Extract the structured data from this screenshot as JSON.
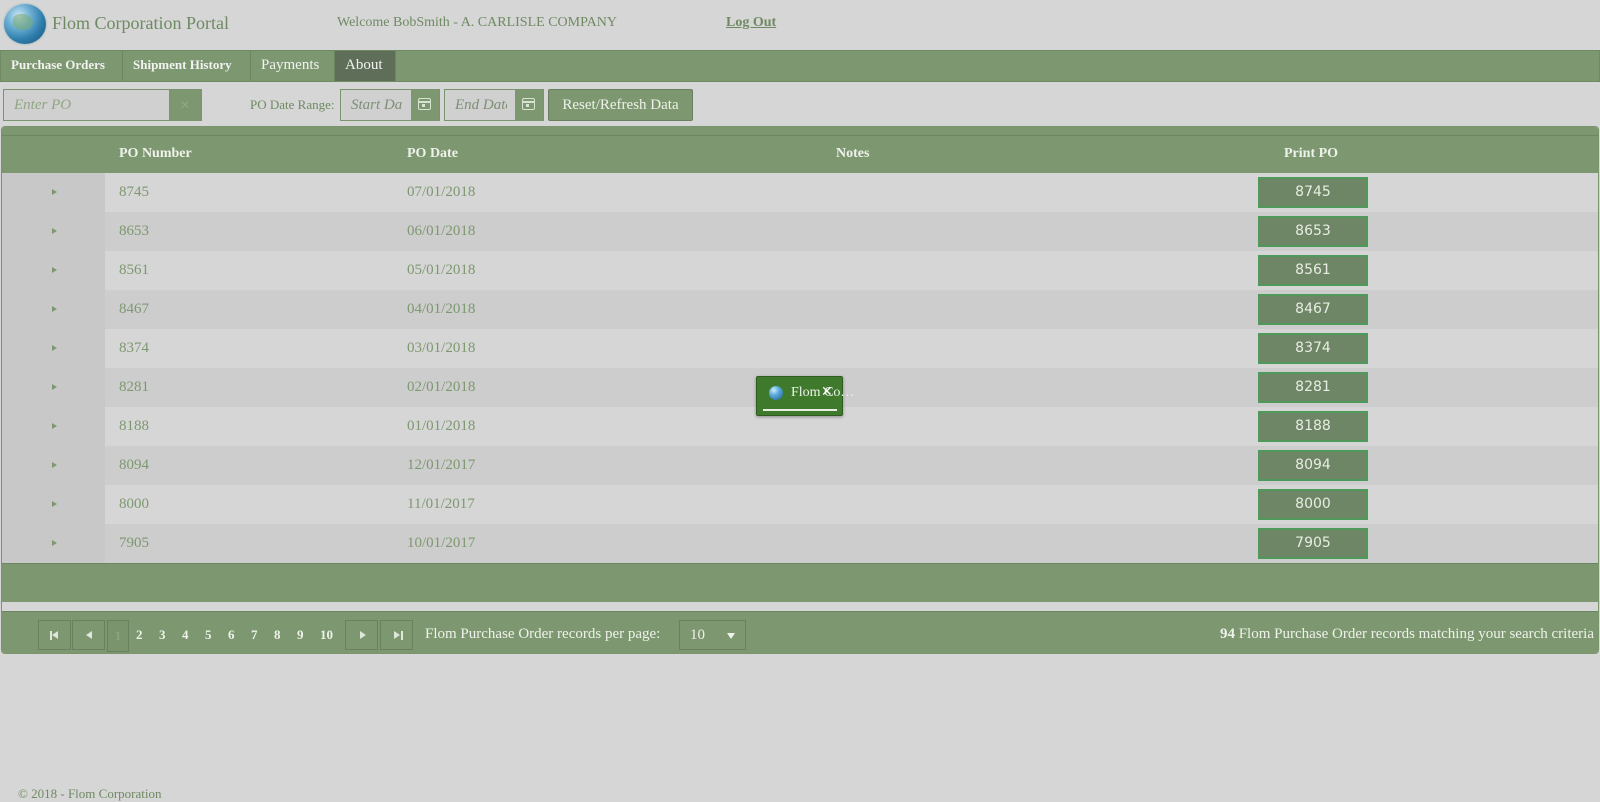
{
  "header": {
    "app_title": "Flom Corporation Portal",
    "welcome": "Welcome BobSmith - A. CARLISLE COMPANY",
    "logout": "Log Out",
    "logo_icon": "globe-icon"
  },
  "nav": {
    "tabs": [
      {
        "label": "Purchase Orders"
      },
      {
        "label": "Shipment History"
      },
      {
        "label": "Payments"
      },
      {
        "label": "About"
      }
    ]
  },
  "filters": {
    "po_placeholder": "Enter PO",
    "clear_icon": "close-icon",
    "date_range_label": "PO Date Range:",
    "start_placeholder": "Start Date",
    "end_placeholder": "End Date",
    "calendar_icon": "calendar-icon",
    "reset_label": "Reset/Refresh Data"
  },
  "grid": {
    "columns": {
      "po_number": "PO Number",
      "po_date": "PO Date",
      "notes": "Notes",
      "print_po": "Print PO"
    },
    "rows": [
      {
        "po": "8745",
        "date": "07/01/2018",
        "notes": "",
        "print": "8745"
      },
      {
        "po": "8653",
        "date": "06/01/2018",
        "notes": "",
        "print": "8653"
      },
      {
        "po": "8561",
        "date": "05/01/2018",
        "notes": "",
        "print": "8561"
      },
      {
        "po": "8467",
        "date": "04/01/2018",
        "notes": "",
        "print": "8467"
      },
      {
        "po": "8374",
        "date": "03/01/2018",
        "notes": "",
        "print": "8374"
      },
      {
        "po": "8281",
        "date": "02/01/2018",
        "notes": "",
        "print": "8281"
      },
      {
        "po": "8188",
        "date": "01/01/2018",
        "notes": "",
        "print": "8188"
      },
      {
        "po": "8094",
        "date": "12/01/2017",
        "notes": "",
        "print": "8094"
      },
      {
        "po": "8000",
        "date": "11/01/2017",
        "notes": "",
        "print": "8000"
      },
      {
        "po": "7905",
        "date": "10/01/2017",
        "notes": "",
        "print": "7905"
      }
    ]
  },
  "pager": {
    "pages": [
      "1",
      "2",
      "3",
      "4",
      "5",
      "6",
      "7",
      "8",
      "9",
      "10"
    ],
    "current_page": "1",
    "per_page_label": "Flom Purchase Order records per page:",
    "per_page_value": "10",
    "records_count": "94",
    "records_text": " Flom Purchase Order records matching your search criteria"
  },
  "popup": {
    "title": "Flom Co…",
    "close_icon": "close-icon"
  },
  "footer": {
    "copyright": "© 2018 - Flom Corporation"
  },
  "colors": {
    "accent": "#7d9870",
    "active_tab": "#5f6e58",
    "popup_bg": "#3f7a2c",
    "background": "#d6d6d6"
  }
}
